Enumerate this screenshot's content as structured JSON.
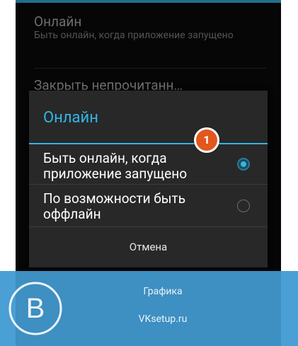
{
  "settings": {
    "online_pref": {
      "title": "Онлайн",
      "summary": "Быть онлайн, когда приложение запущено"
    },
    "close_unread_pref": {
      "title": "Закрыть непрочитанн…"
    }
  },
  "dialog": {
    "title": "Онлайн",
    "options": [
      {
        "label": "Быть онлайн, когда приложение запущено",
        "selected": true
      },
      {
        "label": "По возможности быть оффлайн",
        "selected": false
      }
    ],
    "cancel_label": "Отмена"
  },
  "step_marker": "1",
  "watermark": {
    "logo_letter": "B",
    "line1": "Графика",
    "line2": "VKsetup.ru"
  },
  "colors": {
    "accent": "#33b5e5",
    "dialog_bg": "#282828",
    "marker": "#e2571e",
    "watermark_band": "#4a9fd4"
  }
}
